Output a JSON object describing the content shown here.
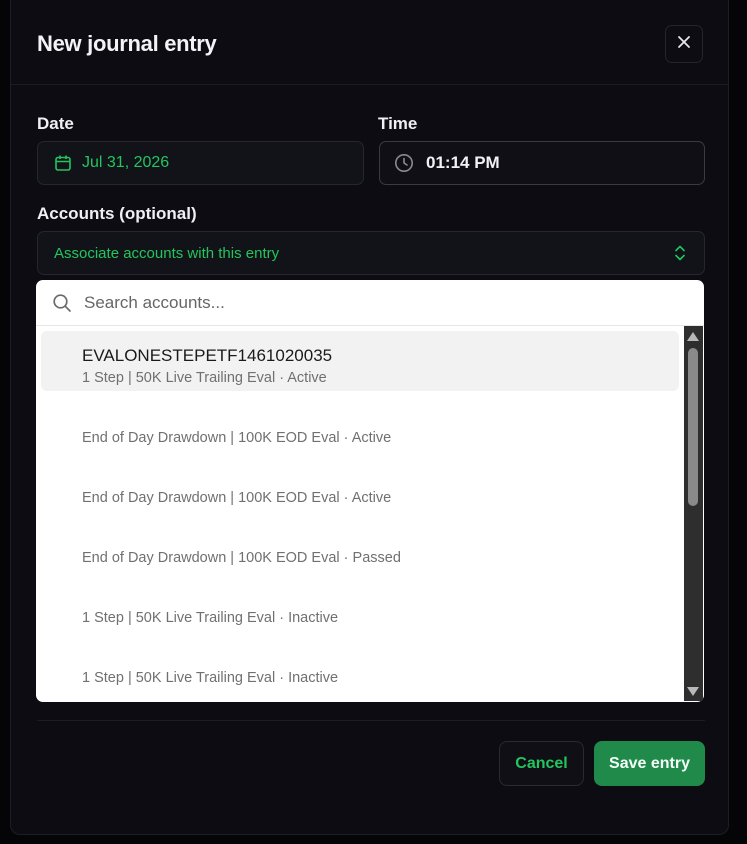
{
  "dialog": {
    "title": "New journal entry"
  },
  "date": {
    "label": "Date",
    "value": "Jul 31, 2026"
  },
  "time": {
    "label": "Time",
    "value": "01:14 PM"
  },
  "accounts": {
    "label": "Accounts (optional)",
    "placeholder": "Associate accounts with this entry"
  },
  "dropdown": {
    "search_placeholder": "Search accounts...",
    "items": [
      {
        "name": "EVALONESTEPETF1461020035",
        "detail": "1 Step | 50K Live Trailing Eval · Active"
      },
      {
        "name": "",
        "detail": "End of Day Drawdown | 100K EOD Eval · Active"
      },
      {
        "name": "",
        "detail": "End of Day Drawdown | 100K EOD Eval · Active"
      },
      {
        "name": "",
        "detail": "End of Day Drawdown | 100K EOD Eval · Passed"
      },
      {
        "name": "",
        "detail": "1 Step | 50K Live Trailing Eval · Inactive"
      },
      {
        "name": "",
        "detail": "1 Step | 50K Live Trailing Eval · Inactive"
      }
    ]
  },
  "footer": {
    "cancel_label": "Cancel",
    "save_label": "Save entry"
  },
  "colors": {
    "accent_green": "#22c55e",
    "save_button": "#1f8a4a"
  },
  "icons": {
    "close": "close-icon",
    "date": "calendar-icon",
    "time": "clock-icon",
    "accounts": "chevron-up-down-icon",
    "search": "search-icon"
  }
}
